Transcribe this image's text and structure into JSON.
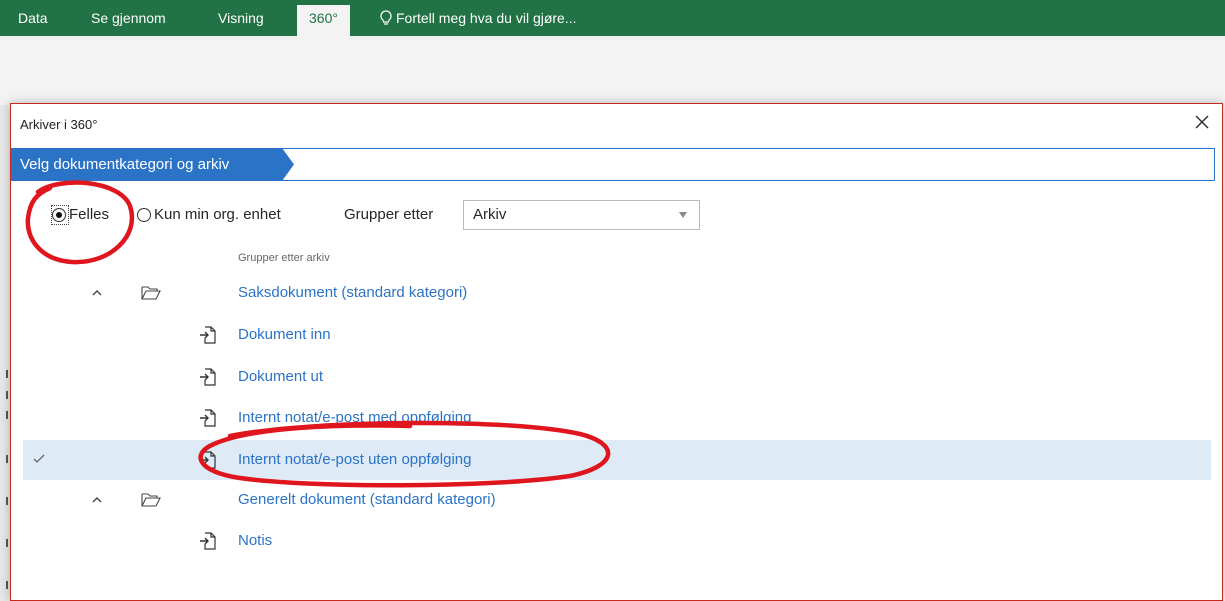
{
  "ribbon": {
    "tabs": [
      "Data",
      "Se gjennom",
      "Visning",
      "360°"
    ],
    "active_tab": "360°",
    "tell_me": "Fortell meg hva du vil gjøre...",
    "tell_me_icon": "lightbulb-icon"
  },
  "dialog": {
    "title": "Arkiver i 360°",
    "close_icon": "close-icon",
    "breadcrumb": "Velg dokumentkategori og arkiv",
    "scope": {
      "option_shared": "Felles",
      "option_own_unit": "Kun min org. enhet",
      "selected": "Felles"
    },
    "group_by": {
      "label": "Grupper etter",
      "value": "Arkiv"
    },
    "list": {
      "group_header": "Grupper etter arkiv",
      "items": [
        {
          "label": "Saksdokument (standard kategori)",
          "kind": "group",
          "selected": false
        },
        {
          "label": "Dokument inn",
          "kind": "document",
          "selected": false
        },
        {
          "label": "Dokument ut",
          "kind": "document",
          "selected": false
        },
        {
          "label": "Internt notat/e-post med oppfølging",
          "kind": "document",
          "selected": false
        },
        {
          "label": "Internt notat/e-post uten oppfølging",
          "kind": "document",
          "selected": true
        },
        {
          "label": "Generelt dokument (standard kategori)",
          "kind": "group",
          "selected": false
        },
        {
          "label": "Notis",
          "kind": "document",
          "selected": false
        }
      ]
    }
  },
  "colors": {
    "ribbon_green": "#217346",
    "accent_blue": "#2b73c7",
    "selection": "#deebf7",
    "annotation_red": "#e0161f"
  }
}
